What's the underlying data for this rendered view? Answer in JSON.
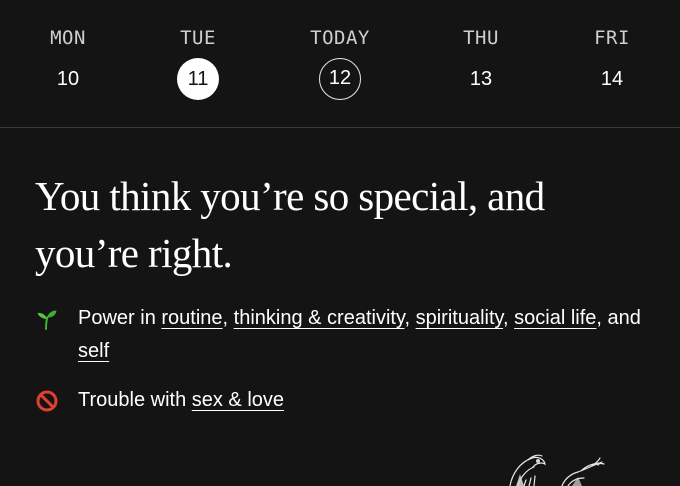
{
  "days": [
    {
      "name": "MON",
      "number": "10"
    },
    {
      "name": "TUE",
      "number": "11"
    },
    {
      "name": "TODAY",
      "number": "12"
    },
    {
      "name": "THU",
      "number": "13"
    },
    {
      "name": "FRI",
      "number": "14"
    }
  ],
  "selected_day": "TUE",
  "today_day": "TODAY",
  "headline": "You think you’re so special, and you’re right.",
  "power": {
    "icon": "seedling-icon",
    "prefix": "Power in ",
    "links": [
      "routine",
      "thinking & creativity",
      "spirituality",
      "social life",
      "self"
    ],
    "separators": [
      ", ",
      ", ",
      ", ",
      ", and "
    ]
  },
  "trouble": {
    "icon": "prohibited-icon",
    "prefix": "Trouble with ",
    "links": [
      "sex & love"
    ]
  },
  "colors": {
    "background": "#141414",
    "text": "#ffffff",
    "muted": "#cfcfcf",
    "divider": "#3a3a3a",
    "seedling_green": "#3fae35",
    "prohibited_red": "#e0402f"
  }
}
